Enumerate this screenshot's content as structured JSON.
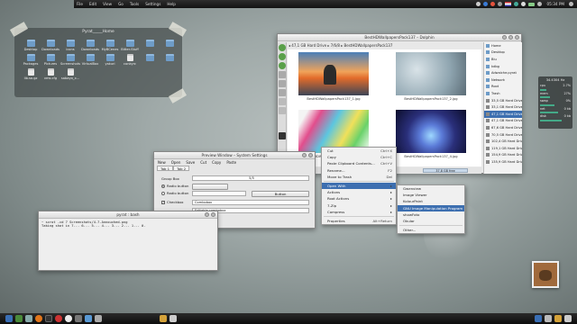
{
  "top_panel": {
    "menus": [
      "File",
      "Edit",
      "View",
      "Go",
      "Tools",
      "Settings",
      "Help"
    ],
    "clock": "05:34 PM"
  },
  "folderview": {
    "title": "Pyrat_____Home",
    "items": [
      {
        "label": "Desktop",
        "icon": "folder-icon"
      },
      {
        "label": "Downloads",
        "icon": "folder-icon"
      },
      {
        "label": "icons",
        "icon": "folder-icon"
      },
      {
        "label": "Downloads",
        "icon": "folder-icon"
      },
      {
        "label": "MyBCenes",
        "icon": "folder-icon"
      },
      {
        "label": "Bitter-Stuff",
        "icon": "folder-icon"
      },
      {
        "label": "",
        "icon": "folder-icon"
      },
      {
        "label": "",
        "icon": "folder-icon"
      },
      {
        "label": "Packages",
        "icon": "folder-icon"
      },
      {
        "label": "Pictures",
        "icon": "folder-icon"
      },
      {
        "label": "Screenshots",
        "icon": "folder-icon"
      },
      {
        "label": "VirtualBox",
        "icon": "folder-icon"
      },
      {
        "label": "yakuri",
        "icon": "folder-icon"
      },
      {
        "label": "conkyrc",
        "icon": "file-icon"
      },
      {
        "label": "",
        "icon": "folder-icon"
      },
      {
        "label": "",
        "icon": "folder-icon"
      },
      {
        "label": "lib.so.gz",
        "icon": "file-icon"
      },
      {
        "label": "vms.cfg",
        "icon": "file-icon"
      },
      {
        "label": "sabayo_x...",
        "icon": "file-icon"
      }
    ]
  },
  "dolphin": {
    "title": "BestHDWallpapersPack137 – Dolphin",
    "breadcrumb": "◂ 47,1 GB Hard Drive  ▸ 7/6/8  ▸ BestHDWallpapersPack137",
    "thumbnails": [
      {
        "label": "BestHDWallpapersPack137_1.jpg"
      },
      {
        "label": "BestHDWallpapersPack137_2.jpg"
      },
      {
        "label": "BestHDWallpapersPack137_3.jpg"
      },
      {
        "label": "BestHDWallpapersPack137_4.jpg"
      }
    ],
    "free_space": "37,8 GB free",
    "places": [
      "Home",
      "Desktop",
      "Biu",
      "kdbg",
      "Adwaiche.pyrat",
      "Network",
      "Root",
      "Trash",
      "33,5 GB Hard Drive",
      "33,1 GB Hard Drive",
      "47,1 GB Hard Drive",
      "47,1 GB Hard Drive",
      "67,6 GB Hard Drive",
      "70,5 GB Hard Drive",
      "102,4 GB Hard Drive",
      "119,1 GB Hard Drive",
      "154,9 GB Hard Drive",
      "135,9 GB Hard Drive"
    ]
  },
  "context_menu": {
    "items": [
      {
        "label": "Cut",
        "shortcut": "Ctrl+X"
      },
      {
        "label": "Copy",
        "shortcut": "Ctrl+C"
      },
      {
        "label": "Paste Clipboard Contents...",
        "shortcut": "Ctrl+V"
      },
      {
        "label": "Rename...",
        "shortcut": "F2"
      },
      {
        "label": "Move to Trash",
        "shortcut": "Del"
      },
      {
        "label": "Open With",
        "shortcut": "▸"
      },
      {
        "label": "Actions",
        "shortcut": "▸"
      },
      {
        "label": "Root Actions",
        "shortcut": "▸"
      },
      {
        "label": "7-Zip",
        "shortcut": "▸"
      },
      {
        "label": "Compress",
        "shortcut": "▸"
      },
      {
        "label": "Properties",
        "shortcut": "Alt+Return"
      }
    ],
    "submenu": [
      "Gwenview",
      "Image Viewer",
      "KolourPaint",
      "GNU Image Manipulation Program",
      "showFoto",
      "Okular",
      "Other..."
    ]
  },
  "preview_window": {
    "title": "Preview Window – System Settings",
    "menus": [
      "New",
      "Open",
      "Save",
      "Cut",
      "Copy",
      "Paste"
    ],
    "tabs": [
      "Tab 1",
      "Tab 2"
    ],
    "group_box": "Group Box",
    "field_value": "5/5",
    "radio1": "Radio button",
    "radio2": "Radio button",
    "checkbox": "Checkbox",
    "button": "Button",
    "combobox": "Combobox",
    "editable_combobox": "Editable combobox"
  },
  "terminal": {
    "title": "pyrat : bash",
    "lines": [
      "~ scrot -cd 7 Screenshots/4-7-Annouched.png",
      "Taking shot in 7... 6... 5... 4... 3... 2... 1... 0."
    ]
  },
  "sysmon": {
    "header": "34.4304 Hz",
    "rows": [
      {
        "k": "cpu",
        "v": "2.7%"
      },
      {
        "k": "mem",
        "v": "27%"
      },
      {
        "k": "swap",
        "v": "0%"
      },
      {
        "k": "net",
        "v": "0 kb"
      },
      {
        "k": "disk",
        "v": "0 kb"
      }
    ]
  },
  "colors": {
    "accent": "#3d6fb0",
    "panel": "#121212"
  }
}
